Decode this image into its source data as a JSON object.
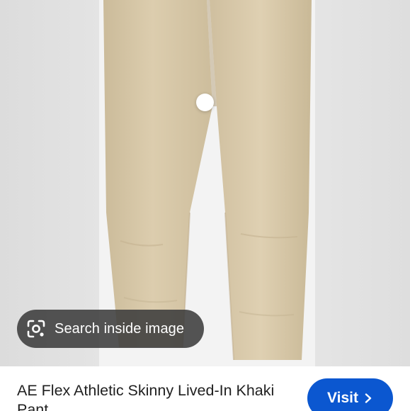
{
  "lens": {
    "search_label": "Search inside image",
    "search_icon": "lens-camera-icon"
  },
  "result": {
    "title": "AE Flex Athletic Skinny Lived-In Khaki Pant",
    "visit_label": "Visit",
    "visit_icon": "chevron-right-icon"
  },
  "colors": {
    "accent": "#0b57d0",
    "pill_background": "#3c3c3c",
    "product_khaki": "#d8c8a8",
    "image_background": "#e6e6e6"
  }
}
